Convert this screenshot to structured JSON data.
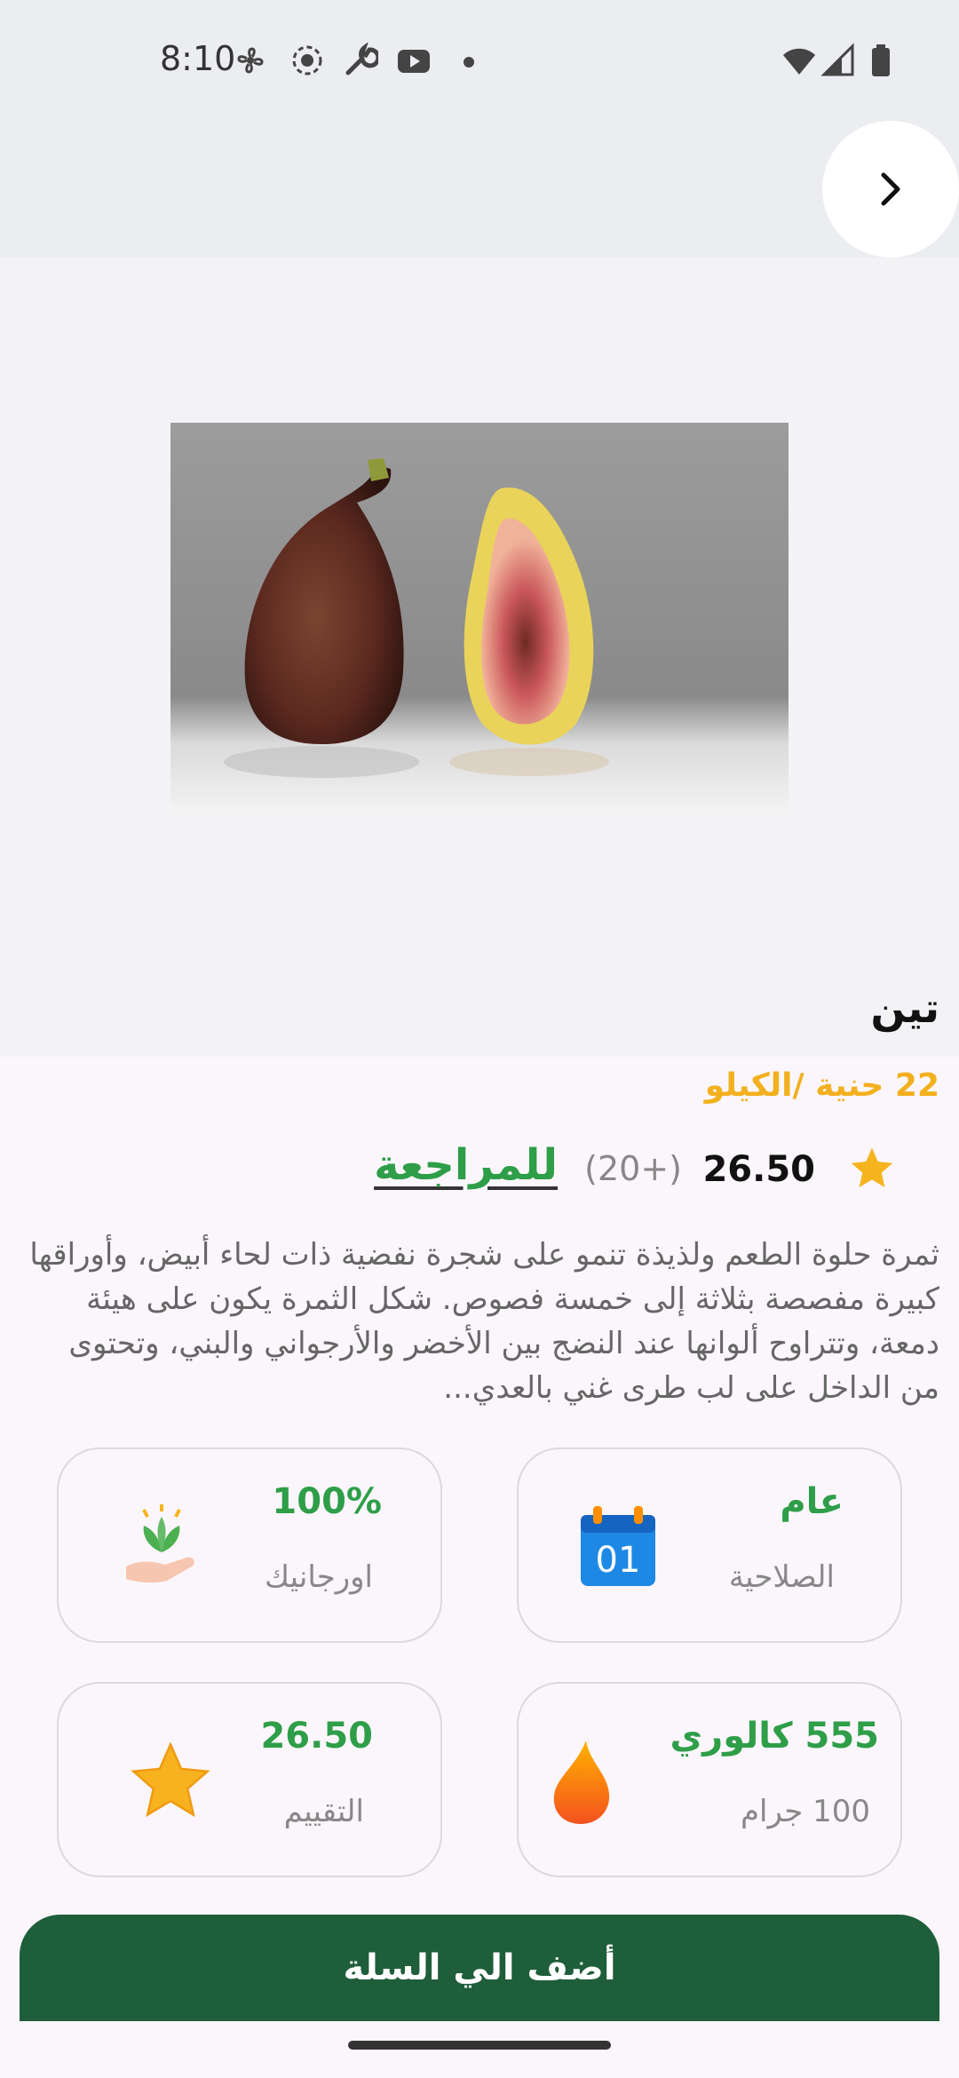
{
  "status_bar": {
    "time": "8:10"
  },
  "product": {
    "title": "تين",
    "price_unit": "22 حنية /الكيلو",
    "rating": "26.50",
    "reviews_count": "(20+)",
    "review_link": "للمراجعة",
    "description": "ثمرة حلوة الطعم ولذيذة تنمو على شجرة نفضية ذات لحاء أبيض، وأوراقها كبيرة مفصصة بثلاثة إلى خمسة فصوص. شكل الثمرة يكون على هيئة دمعة، وتتراوح ألوانها عند النضج بين الأخضر والأرجواني والبني، وتحتوى من الداخل على لب طرى غني بالعدي..."
  },
  "cards": {
    "validity": {
      "value": "عام",
      "label": "الصلاحية",
      "icon": "calendar-icon",
      "icon_text": "01"
    },
    "organic": {
      "value": "100%",
      "label": "اورجانيك",
      "icon": "organic-hand-icon"
    },
    "calories": {
      "value": "555 كالوري",
      "label": "100 جرام",
      "icon": "flame-icon"
    },
    "rating": {
      "value": "26.50",
      "label": "التقييم",
      "icon": "star-icon"
    }
  },
  "cta": {
    "label": "أضف الي السلة"
  },
  "colors": {
    "primary_green": "#2E9E48",
    "dark_green": "#1F5E3A",
    "accent_yellow": "#F2B01E"
  }
}
